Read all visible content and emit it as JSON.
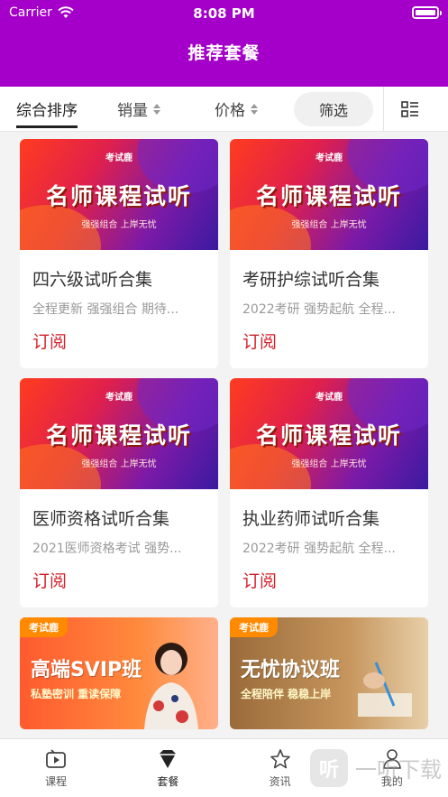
{
  "status": {
    "carrier": "Carrier",
    "time": "8:08 PM"
  },
  "nav": {
    "title": "推荐套餐"
  },
  "sortbar": {
    "comprehensive": "综合排序",
    "sales": "销量",
    "price": "价格",
    "filter": "筛选"
  },
  "banner": {
    "logo": "考试鹿",
    "headline": "名师课程试听",
    "sub": "强强组合 上岸无忧"
  },
  "cards": [
    {
      "title": "四六级试听合集",
      "desc": "全程更新 强强组合 期待...",
      "action": "订阅"
    },
    {
      "title": "考研护综试听合集",
      "desc": "2022考研 强势起航 全程...",
      "action": "订阅"
    },
    {
      "title": "医师资格试听合集",
      "desc": "2021医师资格考试 强势...",
      "action": "订阅"
    },
    {
      "title": "执业药师试听合集",
      "desc": "2022考研 强势起航 全程...",
      "action": "订阅"
    }
  ],
  "promos": [
    {
      "tag": "考试鹿",
      "big": "高端SVIP班",
      "small": "私塾密训 重读保障"
    },
    {
      "tag": "考试鹿",
      "big": "无忧协议班",
      "small": "全程陪伴 稳稳上岸"
    }
  ],
  "tabbar": [
    {
      "label": "课程",
      "icon": "play-icon"
    },
    {
      "label": "套餐",
      "icon": "diamond-icon"
    },
    {
      "label": "资讯",
      "icon": "star-icon"
    },
    {
      "label": "我的",
      "icon": "user-icon"
    }
  ],
  "watermark": {
    "badge": "听",
    "text": "一听下载"
  },
  "colors": {
    "brand": "#a400c9",
    "accent": "#d4202a"
  }
}
